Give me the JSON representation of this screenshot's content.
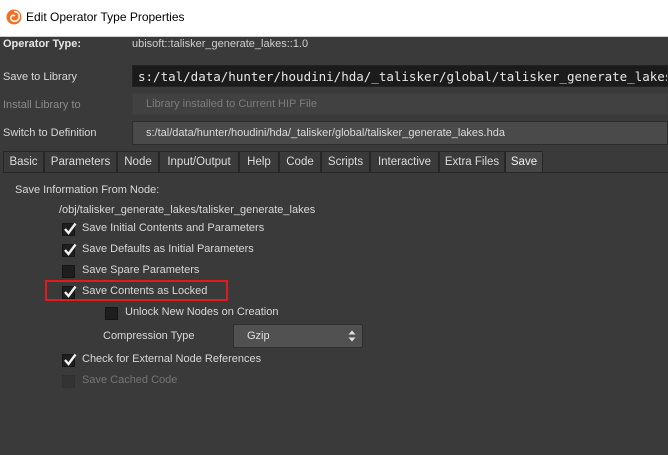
{
  "window": {
    "title": "Edit Operator Type Properties",
    "icon": "houdini-logo-icon"
  },
  "header": {
    "operator_type_label": "Operator Type:",
    "operator_type_value": "ubisoft::talisker_generate_lakes::1.0",
    "save_to_library_label": "Save to Library",
    "save_to_library_value": "s:/tal/data/hunter/houdini/hda/_talisker/global/talisker_generate_lakes.hda",
    "install_library_label": "Install Library to",
    "install_library_value": "Library installed to Current HIP File",
    "switch_definition_label": "Switch to Definition",
    "switch_definition_value": "s:/tal/data/hunter/houdini/hda/_talisker/global/talisker_generate_lakes.hda"
  },
  "tabs": [
    {
      "label": "Basic"
    },
    {
      "label": "Parameters"
    },
    {
      "label": "Node"
    },
    {
      "label": "Input/Output"
    },
    {
      "label": "Help"
    },
    {
      "label": "Code"
    },
    {
      "label": "Scripts"
    },
    {
      "label": "Interactive"
    },
    {
      "label": "Extra Files"
    },
    {
      "label": "Save",
      "active": true
    }
  ],
  "save_panel": {
    "section_label": "Save Information From Node:",
    "node_path": "/obj/talisker_generate_lakes/talisker_generate_lakes",
    "options": {
      "initial_contents": {
        "label": "Save Initial Contents and Parameters",
        "checked": true
      },
      "defaults_initial": {
        "label": "Save Defaults as Initial Parameters",
        "checked": true
      },
      "spare_params": {
        "label": "Save Spare Parameters",
        "checked": false
      },
      "contents_locked": {
        "label": "Save Contents as Locked",
        "checked": true
      },
      "unlock_nodes": {
        "label": "Unlock New Nodes on Creation",
        "checked": false
      },
      "external_refs": {
        "label": "Check for External Node References",
        "checked": true
      },
      "cached_code": {
        "label": "Save Cached Code",
        "checked": false,
        "disabled": true
      }
    },
    "compression": {
      "label": "Compression Type",
      "value": "Gzip"
    }
  },
  "colors": {
    "highlight": "#e11b1b",
    "background": "#3a3a3a",
    "field_dark": "#1b1b1b"
  }
}
